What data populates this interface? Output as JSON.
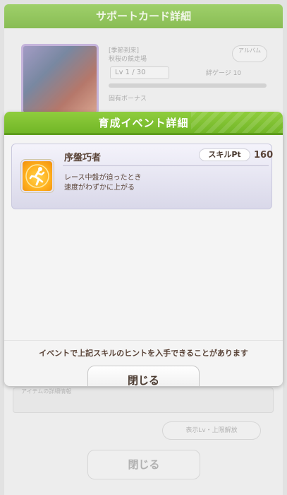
{
  "background": {
    "header_title": "サポートカード詳細",
    "card_info_line1": "[季節到来]",
    "card_info_line2": "秋桜の競走場",
    "small_button_label": "アルバム",
    "level_text": "Lv 1 / 30",
    "level_right": "絆ゲージ 10",
    "row_text": "固有ボーナス",
    "list_text": "アイテムの詳細情報",
    "secondary_button_label": "表示Lv・上限解放",
    "close_button_label": "閉じる"
  },
  "modal": {
    "title": "育成イベント詳細",
    "skill": {
      "name": "序盤巧者",
      "pt_label": "スキルPt",
      "pt_value": "160",
      "description_line1": "レース中盤が迫ったとき",
      "description_line2": "速度がわずかに上がる",
      "icon": "running-speed-icon"
    },
    "info_message": "イベントで上記スキルのヒントを入手できることがあります",
    "close_button_label": "閉じる"
  },
  "colors": {
    "header_green": "#7cbf33",
    "text_brown": "#5a4438",
    "skill_icon_orange": "#ffb01e"
  }
}
